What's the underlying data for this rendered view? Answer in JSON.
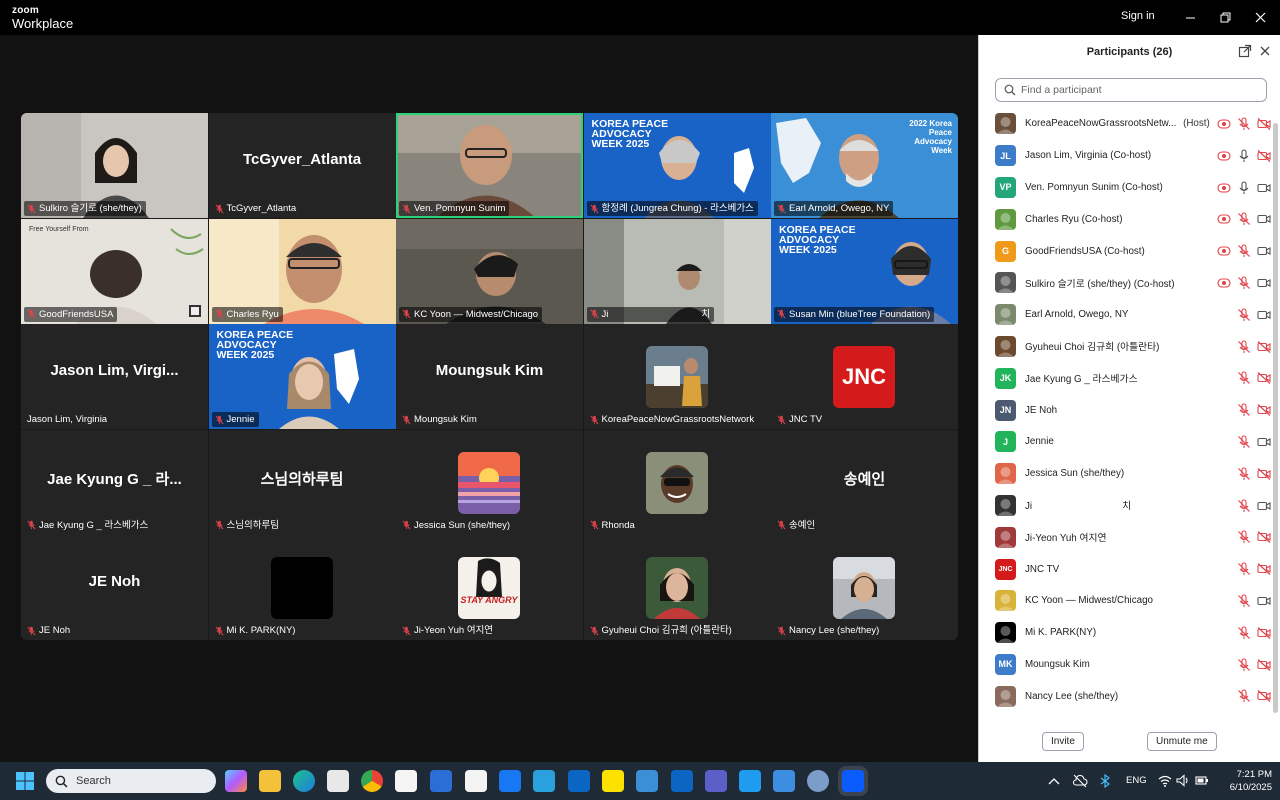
{
  "window": {
    "brand_line1": "zoom",
    "brand_line2": "Workplace",
    "signin_label": "Sign in"
  },
  "grid": {
    "tiles": [
      {
        "name": "Sulkiro 슬기로 (she/they)",
        "kind": "video"
      },
      {
        "name": "TcGyver_Atlanta",
        "big": "TcGyver_Atlanta",
        "kind": "name"
      },
      {
        "name": "Ven. Pomnyun Sunim",
        "kind": "video",
        "active": true
      },
      {
        "name": "함정례 (Jungrea Chung) - 라스베가스",
        "kind": "video",
        "bg_text": "KOREA PEACE ADVOCACY WEEK 2025"
      },
      {
        "name": "Earl Arnold, Owego, NY",
        "kind": "video",
        "bg_text": "2022 Korea Peace Advocacy Week"
      },
      {
        "name": "GoodFriendsUSA",
        "kind": "video",
        "bg_text": "Free Yourself From"
      },
      {
        "name": "Charles Ryu",
        "kind": "video"
      },
      {
        "name": "KC Yoon — Midwest/Chicago",
        "kind": "video"
      },
      {
        "name": "Ji",
        "name_tail": "치",
        "kind": "video"
      },
      {
        "name": "Susan Min (blueTree Foundation)",
        "kind": "video",
        "bg_text": "KOREA PEACE ADVOCACY WEEK 2025"
      },
      {
        "name": "Jason Lim, Virginia",
        "big": "Jason Lim, Virgi...",
        "kind": "name"
      },
      {
        "name": "Jennie",
        "kind": "video",
        "bg_text": "KOREA PEACE ADVOCACY WEEK 2025"
      },
      {
        "name": "Moungsuk Kim",
        "big": "Moungsuk Kim",
        "kind": "name"
      },
      {
        "name": "KoreaPeaceNowGrassrootsNetwork",
        "kind": "avatar",
        "avatar": "kpn"
      },
      {
        "name": "JNC TV",
        "kind": "avatar",
        "avatar": "jnc",
        "avatar_text": "JNC"
      },
      {
        "name": "Jae Kyung G _ 라스베가스",
        "big": "Jae Kyung G _ 라...",
        "kind": "name"
      },
      {
        "name": "스님의하루팀",
        "big": "스님의하루팀",
        "kind": "name"
      },
      {
        "name": "Jessica Sun (she/they)",
        "kind": "avatar",
        "avatar": "sunset"
      },
      {
        "name": "Rhonda",
        "kind": "avatar",
        "avatar": "rhonda"
      },
      {
        "name": "송예인",
        "big": "송예인",
        "kind": "name"
      },
      {
        "name": "JE Noh",
        "big": "JE Noh",
        "kind": "name"
      },
      {
        "name": "Mi K. PARK(NY)",
        "kind": "avatar",
        "avatar": "black"
      },
      {
        "name": "Ji-Yeon Yuh 여지연",
        "kind": "avatar",
        "avatar": "stay",
        "avatar_text": "STAY ANGRY"
      },
      {
        "name": "Gyuheui Choi 김규희 (아틀란타)",
        "kind": "avatar",
        "avatar": "gyuheui"
      },
      {
        "name": "Nancy Lee (she/they)",
        "kind": "avatar",
        "avatar": "nancy"
      }
    ]
  },
  "panel": {
    "title": "Participants (26)",
    "search_placeholder": "Find a participant",
    "participants": [
      {
        "name": "KoreaPeaceNowGrassrootsNetw...",
        "role": "(Host)",
        "avatar": "img",
        "color": "#6a4f3a",
        "rec": true,
        "mic": "off",
        "cam": "off"
      },
      {
        "name": "Jason Lim, Virginia (Co-host)",
        "avatar": "JL",
        "color": "#3d7cc9",
        "rec": true,
        "mic": "on",
        "cam": "off"
      },
      {
        "name": "Ven. Pomnyun Sunim (Co-host)",
        "avatar": "VP",
        "color": "#22a67a",
        "rec": true,
        "mic": "on",
        "cam": "on"
      },
      {
        "name": "Charles Ryu (Co-host)",
        "avatar": "img",
        "color": "#5f9a3e",
        "rec": true,
        "mic": "off",
        "cam": "on"
      },
      {
        "name": "GoodFriendsUSA (Co-host)",
        "avatar": "G",
        "color": "#f09a1a",
        "rec": true,
        "mic": "off",
        "cam": "on"
      },
      {
        "name": "Sulkiro 슬기로 (she/they) (Co-host)",
        "avatar": "img",
        "color": "#555555",
        "rec": true,
        "mic": "off",
        "cam": "on"
      },
      {
        "name": "Earl Arnold, Owego, NY",
        "avatar": "img",
        "color": "#7a8a6a",
        "rec": false,
        "mic": "off",
        "cam": "on"
      },
      {
        "name": "Gyuheui Choi 김규희 (아틀란타)",
        "avatar": "img",
        "color": "#6b4a2e",
        "rec": false,
        "mic": "off",
        "cam": "off"
      },
      {
        "name": "Jae Kyung G _ 라스베가스",
        "avatar": "JK",
        "color": "#22b45a",
        "rec": false,
        "mic": "off",
        "cam": "off"
      },
      {
        "name": "JE Noh",
        "avatar": "JN",
        "color": "#4b5a70",
        "rec": false,
        "mic": "off",
        "cam": "off"
      },
      {
        "name": "Jennie",
        "avatar": "J",
        "color": "#22b45a",
        "rec": false,
        "mic": "off",
        "cam": "on"
      },
      {
        "name": "Jessica Sun (she/they)",
        "avatar": "img",
        "color": "#e0664a",
        "rec": false,
        "mic": "off",
        "cam": "off"
      },
      {
        "name": "Ji",
        "name_tail": "치",
        "avatar": "img",
        "color": "#333333",
        "rec": false,
        "mic": "off",
        "cam": "on"
      },
      {
        "name": "Ji-Yeon Yuh 여지연",
        "avatar": "img",
        "color": "#a03a3a",
        "rec": false,
        "mic": "off",
        "cam": "off"
      },
      {
        "name": "JNC TV",
        "avatar": "JNC",
        "color": "#d41a1a",
        "rec": false,
        "mic": "off",
        "cam": "off"
      },
      {
        "name": "KC Yoon — Midwest/Chicago",
        "avatar": "img",
        "color": "#d9b23a",
        "rec": false,
        "mic": "off",
        "cam": "on"
      },
      {
        "name": "Mi K. PARK(NY)",
        "avatar": "img",
        "color": "#000000",
        "rec": false,
        "mic": "off",
        "cam": "off"
      },
      {
        "name": "Moungsuk Kim",
        "avatar": "MK",
        "color": "#3d7cc9",
        "rec": false,
        "mic": "off",
        "cam": "off"
      },
      {
        "name": "Nancy Lee (she/they)",
        "avatar": "img",
        "color": "#8a6a5a",
        "rec": false,
        "mic": "off",
        "cam": "off"
      }
    ],
    "invite_label": "Invite",
    "unmute_label": "Unmute me"
  },
  "taskbar": {
    "search_label": "Search",
    "lang": "ENG",
    "time": "7:21 PM",
    "date": "6/10/2025"
  },
  "colors": {
    "active_speaker": "#2bd27a",
    "mic_off_red": "#e0434a",
    "kpaw_blue": "#1a63c6"
  }
}
